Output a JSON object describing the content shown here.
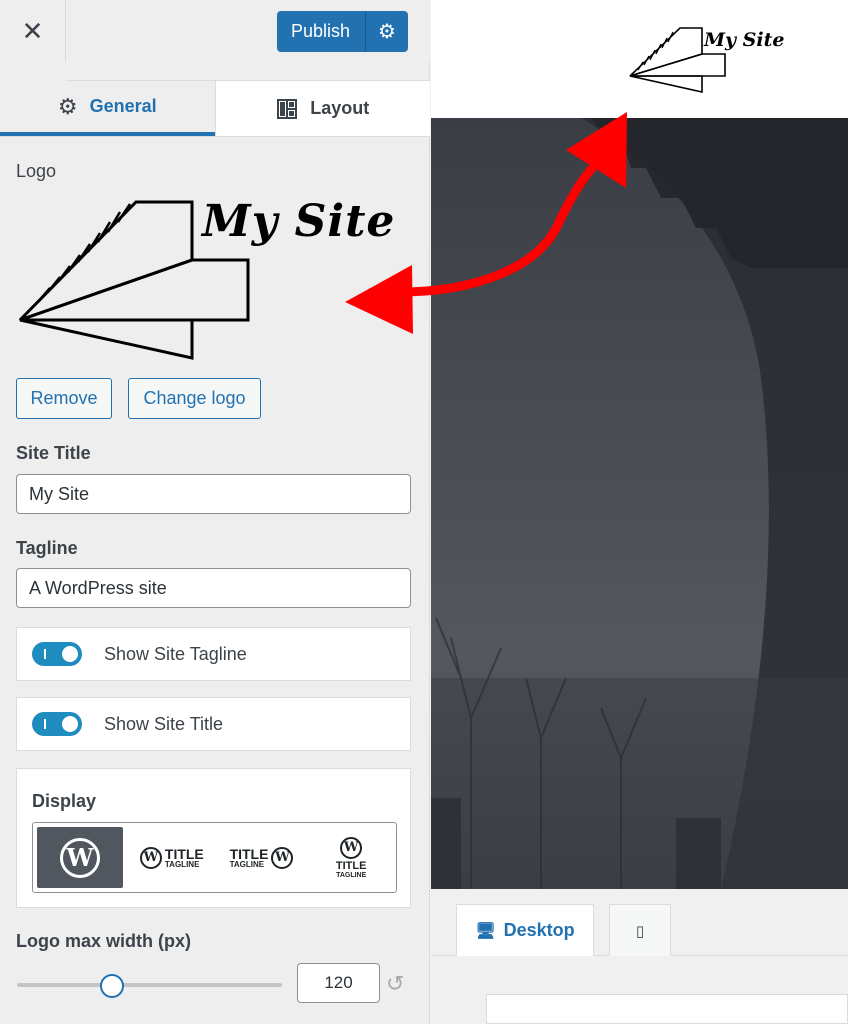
{
  "topbar": {
    "close_glyph": "✕",
    "publish_label": "Publish",
    "publish_settings_icon": "gear-icon"
  },
  "tabs": [
    {
      "label": "General",
      "icon": "gear-icon",
      "active": true
    },
    {
      "label": "Layout",
      "icon": "layout-grid-icon",
      "active": false
    }
  ],
  "logo": {
    "label": "Logo",
    "image_text": "My Site",
    "remove_label": "Remove",
    "change_label": "Change logo"
  },
  "site_title": {
    "label": "Site Title",
    "value": "My Site"
  },
  "tagline": {
    "label": "Tagline",
    "value": "A WordPress site"
  },
  "toggles": [
    {
      "label": "Show Site Tagline",
      "on": true
    },
    {
      "label": "Show Site Title",
      "on": true
    }
  ],
  "display": {
    "label": "Display",
    "options": [
      {
        "name": "logo-only",
        "selected": true
      },
      {
        "name": "logo-left-title",
        "title": "TITLE",
        "tagline": "TAGLINE"
      },
      {
        "name": "logo-right-title",
        "title": "TITLE",
        "tagline": "TAGLINE"
      },
      {
        "name": "logo-top-title",
        "title": "TITLE",
        "tagline": "TAGLINE"
      }
    ]
  },
  "logo_width": {
    "label": "Logo max width (px)",
    "value": "120",
    "slider_fraction": 0.36
  },
  "preview": {
    "logo_text": "My Site",
    "device_tabs": [
      {
        "label": "Desktop",
        "icon": "desktop-icon",
        "active": true
      },
      {
        "label": "",
        "icon": "mobile-icon",
        "active": false
      }
    ]
  },
  "colors": {
    "accent": "#2271b1",
    "arrow": "#ff0000",
    "sidebar_bg": "#eeeeee"
  }
}
